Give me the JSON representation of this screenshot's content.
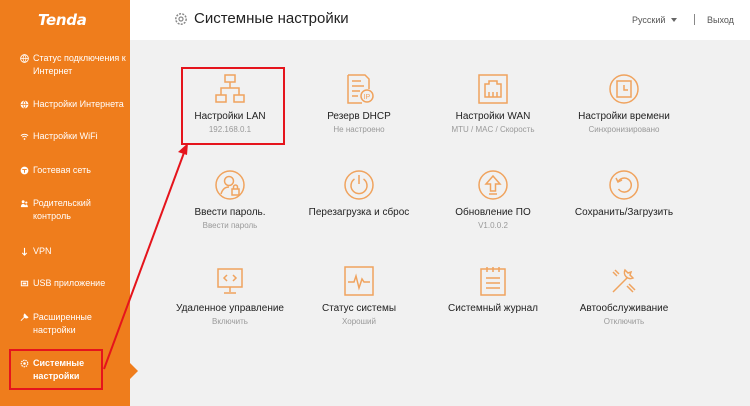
{
  "brand": {
    "logo": "Tenda"
  },
  "sidebar": {
    "items": [
      {
        "label": "Статус подключения к Интернет",
        "icon": "globe-icon"
      },
      {
        "label": "Настройки Интернета",
        "icon": "globe-icon"
      },
      {
        "label": "Настройки WiFi",
        "icon": "wifi-icon"
      },
      {
        "label": "Гостевая сеть",
        "icon": "guest-icon"
      },
      {
        "label": "Родительский контроль",
        "icon": "parental-icon"
      },
      {
        "label": "VPN",
        "icon": "vpn-icon"
      },
      {
        "label": "USB приложение",
        "icon": "usb-icon"
      },
      {
        "label": "Расширенные настройки",
        "icon": "advanced-icon"
      },
      {
        "label": "Системные настройки",
        "icon": "gear-icon",
        "active": true
      }
    ]
  },
  "header": {
    "title": "Системные настройки",
    "language": "Русский",
    "logout": "Выход"
  },
  "tiles": [
    {
      "label": "Настройки LAN",
      "sub": "192.168.0.1",
      "icon": "lan-topology-icon"
    },
    {
      "label": "Резерв DHCP",
      "sub": "Не настроено",
      "icon": "dhcp-reservation-icon"
    },
    {
      "label": "Настройки WAN",
      "sub": "MTU / MAC / Скорость",
      "icon": "wan-port-icon"
    },
    {
      "label": "Настройки времени",
      "sub": "Синхронизировано",
      "icon": "clock-icon"
    },
    {
      "label": "Ввести пароль.",
      "sub": "Ввести пароль",
      "icon": "user-lock-icon"
    },
    {
      "label": "Перезагрузка и сброс",
      "sub": "",
      "icon": "power-icon"
    },
    {
      "label": "Обновление ПО",
      "sub": "V1.0.0.2",
      "icon": "upgrade-icon"
    },
    {
      "label": "Сохранить/Загрузить",
      "sub": "",
      "icon": "backup-restore-icon"
    },
    {
      "label": "Удаленное управление",
      "sub": "Включить",
      "icon": "remote-management-icon"
    },
    {
      "label": "Статус системы",
      "sub": "Хороший",
      "icon": "system-status-icon"
    },
    {
      "label": "Системный журнал",
      "sub": "",
      "icon": "system-log-icon"
    },
    {
      "label": "Автообслуживание",
      "sub": "Отключить",
      "icon": "auto-maintenance-icon"
    }
  ],
  "colors": {
    "accent": "#ef7d1c",
    "sidebar_bg": "#ef7d1c",
    "annotation": "#e5141c",
    "icon": "#f0a35e"
  }
}
